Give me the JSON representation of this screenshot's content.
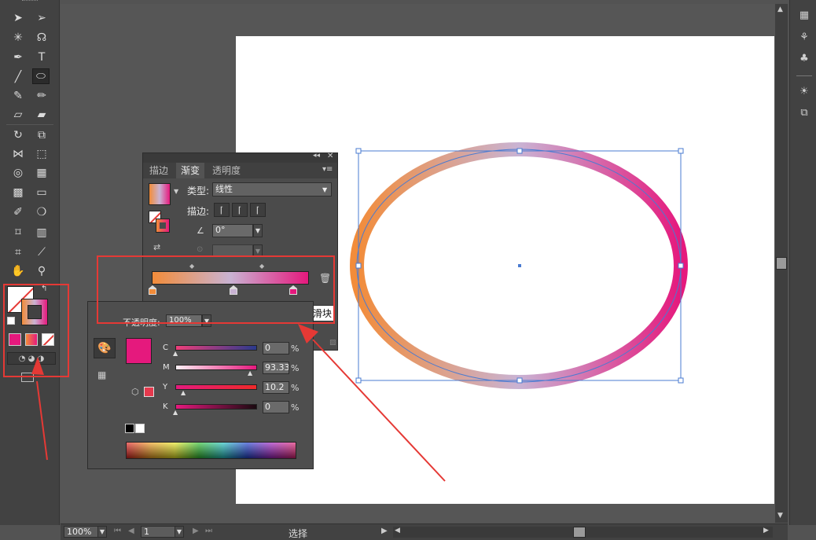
{
  "statusbar": {
    "zoom": "100%",
    "artboard_number": "1",
    "tool_label": "选择"
  },
  "gradient_panel": {
    "tabs": [
      "描边",
      "渐变",
      "透明度"
    ],
    "type_label": "类型:",
    "type_value": "线性",
    "stroke_label": "描边:",
    "angle_value": "0°",
    "tooltip": "渐变滑块",
    "stops": [
      "#f28c3a",
      "#c9b3d3",
      "#e5197d"
    ]
  },
  "opacity_row": {
    "label": "不透明度:",
    "value": "100%"
  },
  "color_panel": {
    "channels": [
      {
        "name": "C",
        "value": "0",
        "unit": "%"
      },
      {
        "name": "M",
        "value": "93.33",
        "unit": "%"
      },
      {
        "name": "Y",
        "value": "10.2",
        "unit": "%"
      },
      {
        "name": "K",
        "value": "0",
        "unit": "%"
      }
    ],
    "swatch_color": "#e5197d"
  },
  "colors": {
    "gradient_start": "#f28c3a",
    "gradient_mid": "#c9b3d3",
    "gradient_end": "#e5197d",
    "highlight_red": "#e53935",
    "selection_blue": "#4a7bd1"
  },
  "icons": {
    "toolbar": [
      "selection-icon",
      "direct-selection-icon",
      "magic-wand-icon",
      "lasso-icon",
      "pen-icon",
      "type-icon",
      "line-icon",
      "ellipse-icon",
      "paintbrush-icon",
      "pencil-icon",
      "blob-brush-icon",
      "eraser-icon",
      "rotate-icon",
      "scale-icon",
      "width-icon",
      "free-transform-icon",
      "shape-builder-icon",
      "perspective-grid-icon",
      "mesh-icon",
      "gradient-icon",
      "eyedropper-icon",
      "blend-icon",
      "symbol-sprayer-icon",
      "column-graph-icon",
      "artboard-icon",
      "slice-icon",
      "hand-icon",
      "zoom-icon"
    ],
    "right_dock": [
      "swatches-icon",
      "brushes-icon",
      "symbols-icon",
      "appearance-icon",
      "layers-icon"
    ]
  }
}
